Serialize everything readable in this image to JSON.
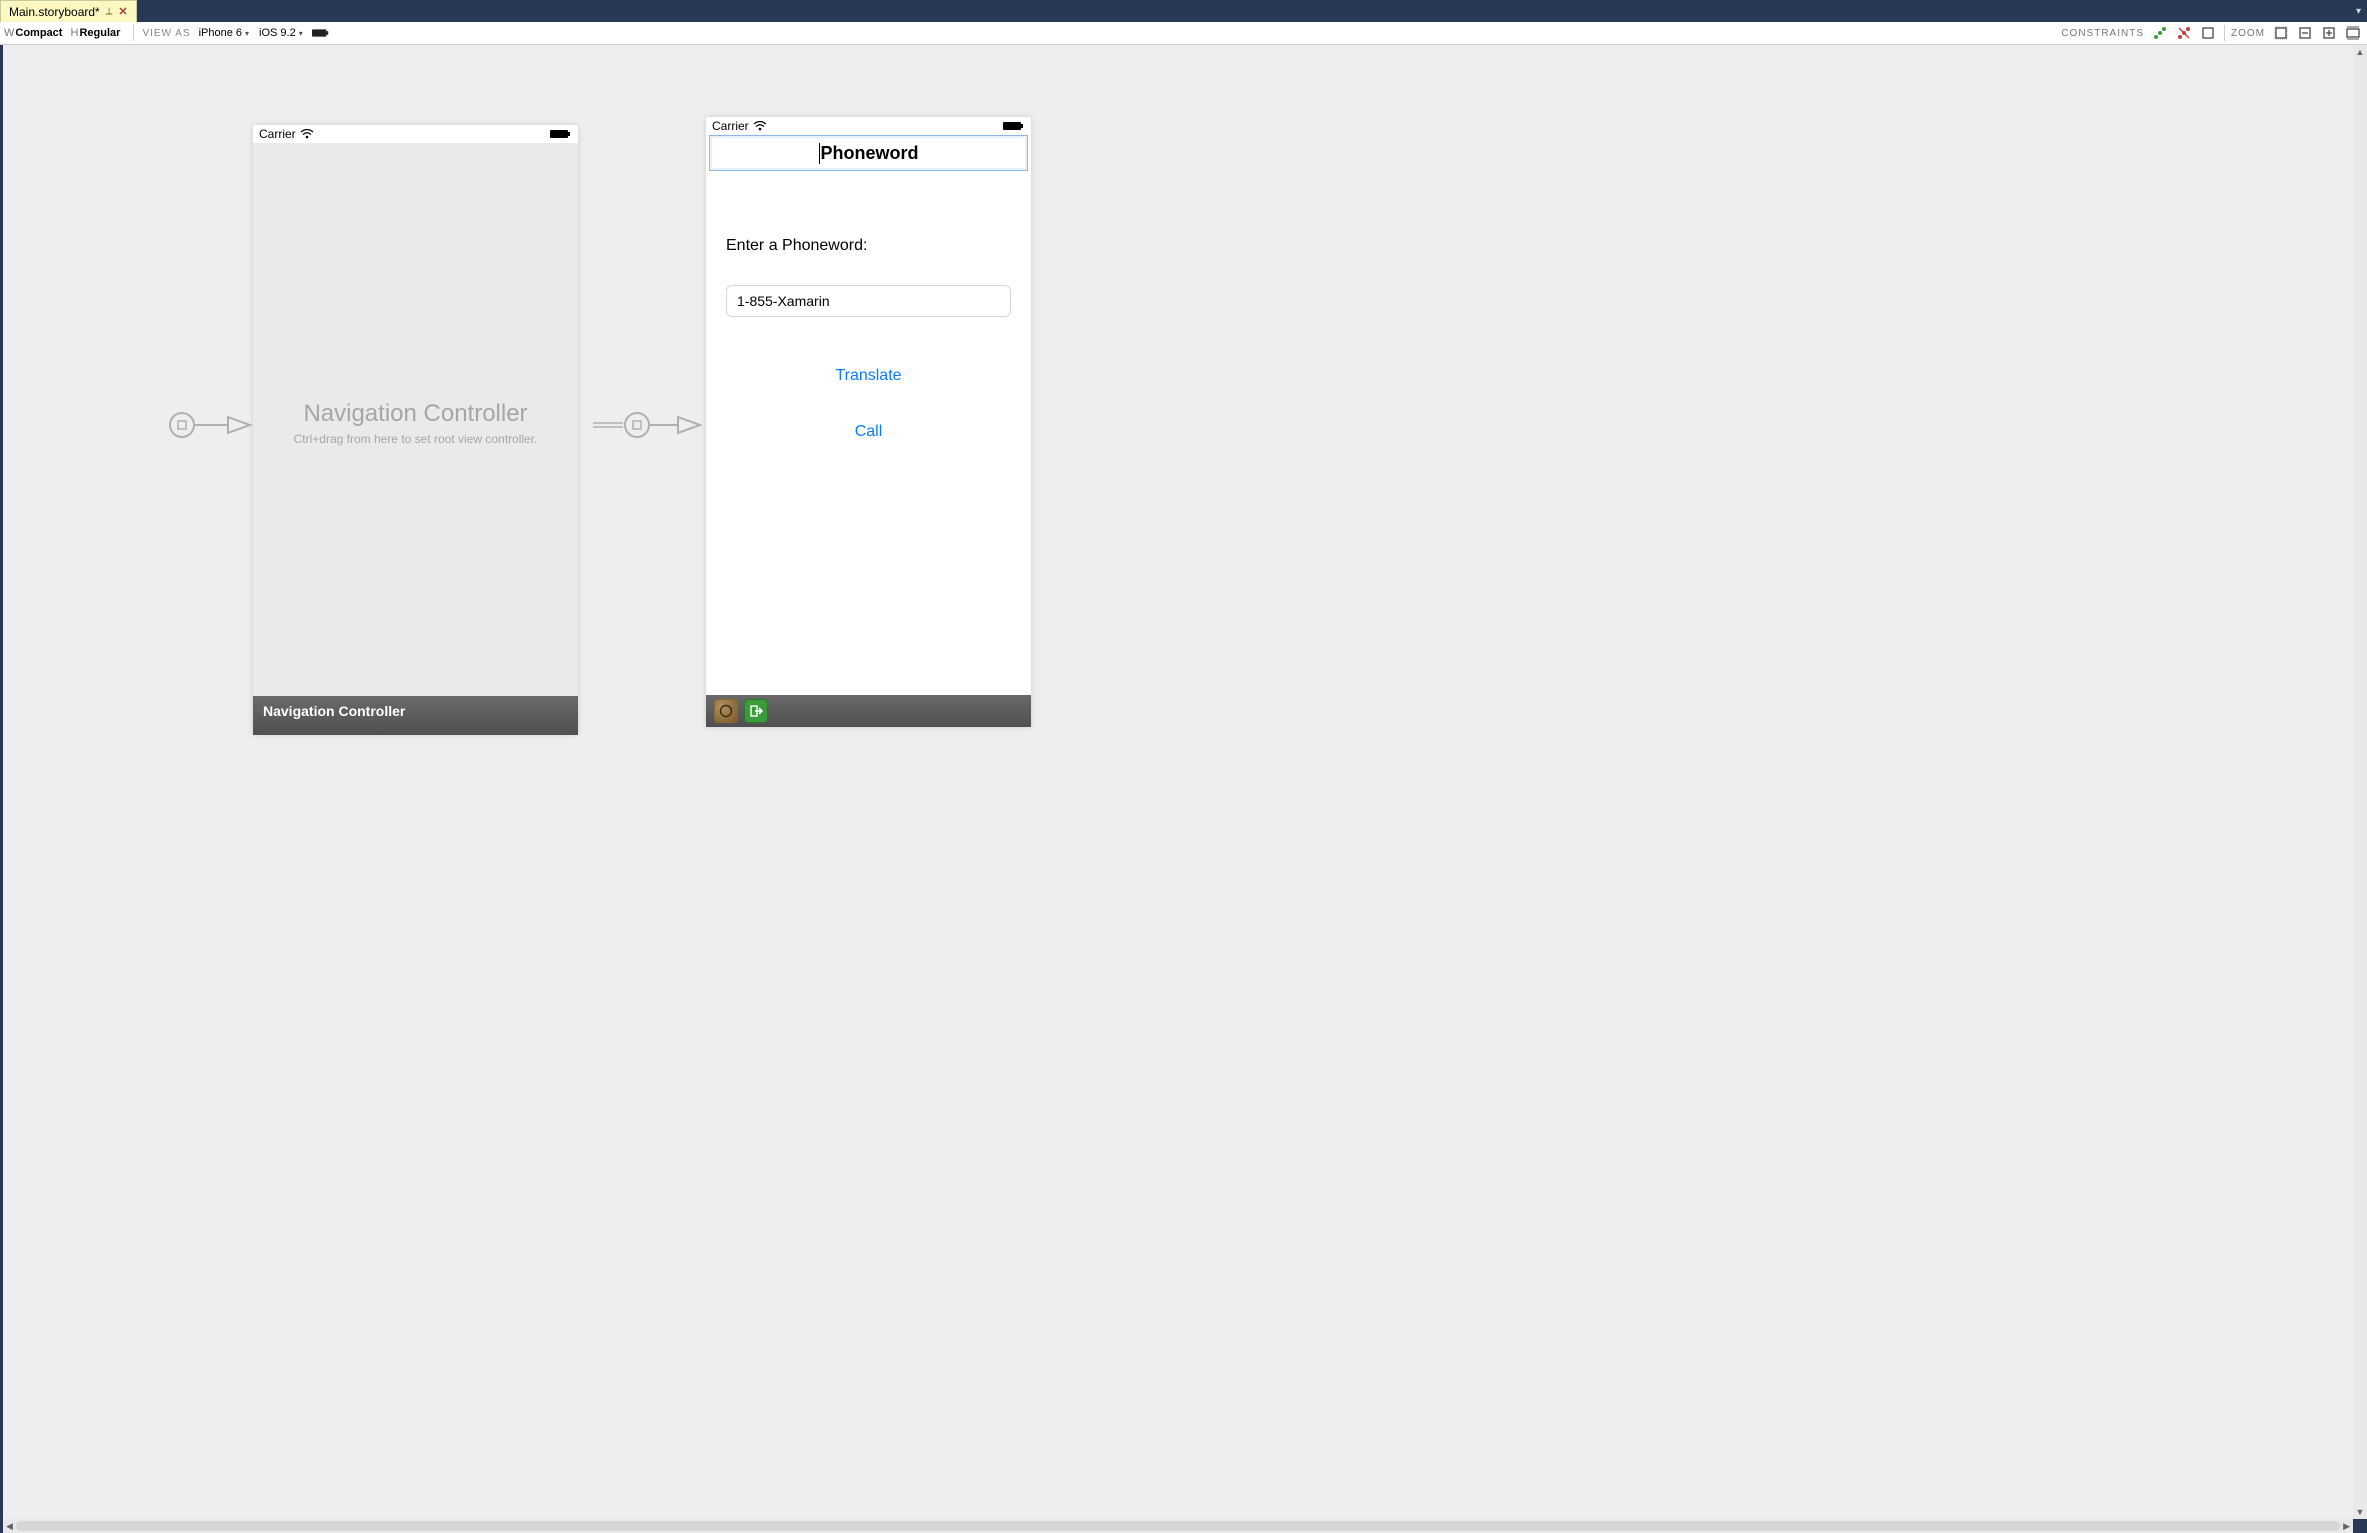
{
  "tabstrip": {
    "tab_title": "Main.storyboard*",
    "overflow_caret": "▾"
  },
  "toolbar": {
    "size_w_label": "W",
    "size_w_value": "Compact",
    "size_h_label": "H",
    "size_h_value": "Regular",
    "viewas_label": "VIEW AS",
    "device_value": "iPhone 6",
    "ios_value": "iOS 9.2",
    "constraints_label": "CONSTRAINTS",
    "zoom_label": "ZOOM"
  },
  "scene_nav": {
    "carrier": "Carrier",
    "title": "Navigation Controller",
    "subtitle": "Ctrl+drag from here to set root view controller.",
    "footer": "Navigation Controller"
  },
  "scene_phoneword": {
    "carrier": "Carrier",
    "nav_title": "Phoneword",
    "label": "Enter a Phoneword:",
    "textfield_value": "1-855-Xamarin",
    "translate_button": "Translate",
    "call_button": "Call"
  },
  "icons": {
    "constraints_add": "constraints-add-icon",
    "constraints_remove": "constraints-remove-icon",
    "constraints_frame": "constraints-frame-icon",
    "zoom_reset": "zoom-reset-icon",
    "zoom_out": "zoom-out-icon",
    "zoom_in": "zoom-in-icon",
    "zoom_fit": "zoom-fit-icon"
  }
}
